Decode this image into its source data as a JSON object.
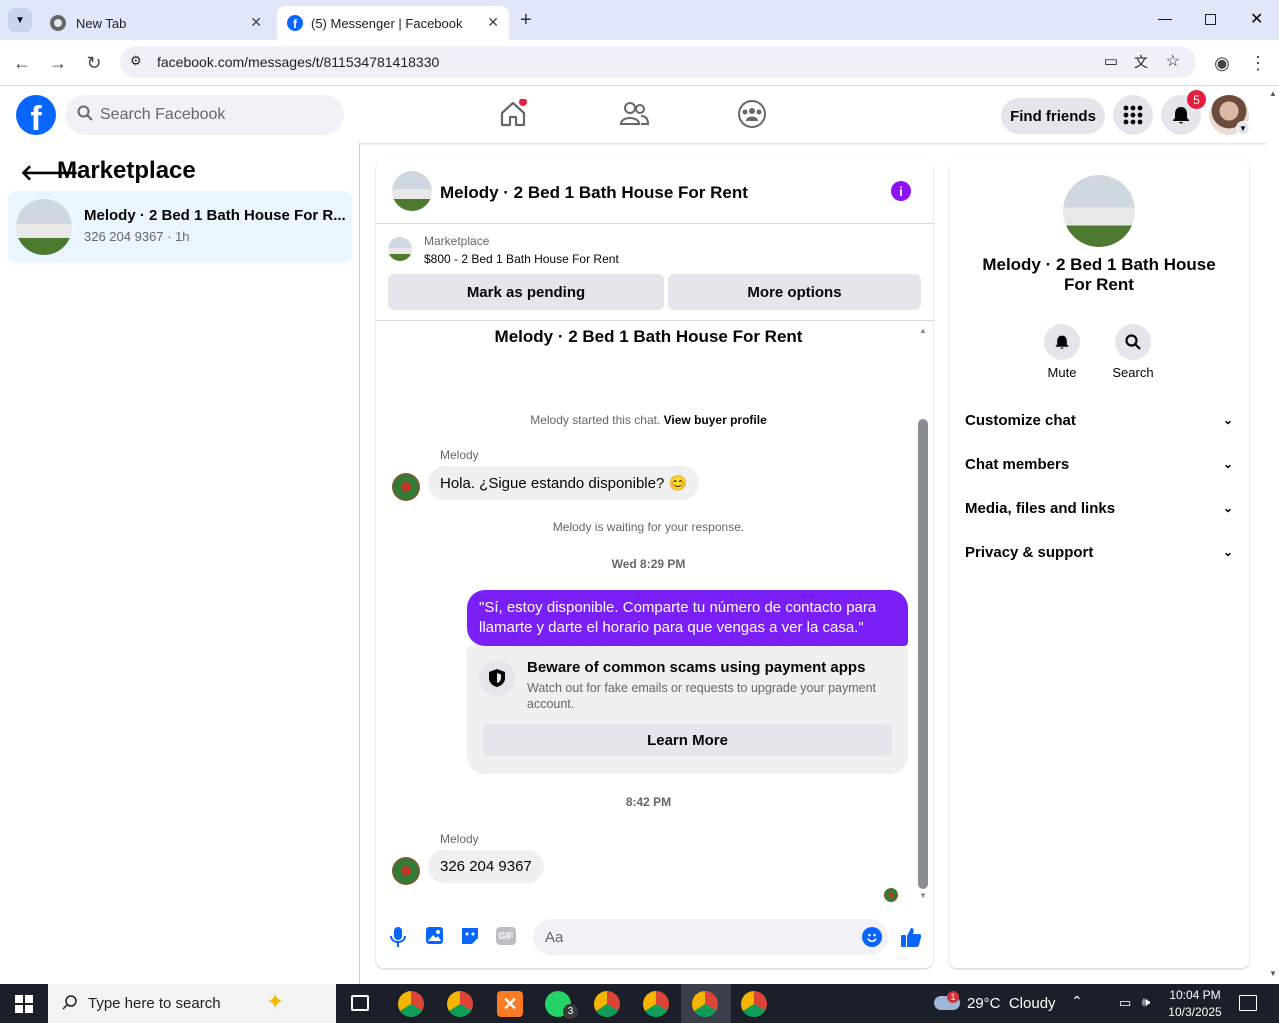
{
  "browser": {
    "tabs": [
      {
        "title": "New Tab",
        "active": false
      },
      {
        "title": "(5) Messenger | Facebook",
        "active": true
      }
    ],
    "url": "facebook.com/messages/t/811534781418330"
  },
  "fb_header": {
    "search_placeholder": "Search Facebook",
    "find_friends": "Find friends",
    "notifications_count": "5"
  },
  "left_panel": {
    "title": "Marketplace",
    "conversation": {
      "name": "Melody · 2 Bed 1 Bath House For R...",
      "preview": "326 204 9367 · 1h"
    }
  },
  "chat": {
    "title": "Melody · 2 Bed 1 Bath House For Rent",
    "listing_label": "Marketplace",
    "listing_price": "$800 - 2 Bed 1 Bath House For Rent",
    "mark_pending": "Mark as pending",
    "more_options": "More options",
    "thread_title": "Melody · 2 Bed 1 Bath House For Rent",
    "started_text": "Melody started this chat.",
    "view_profile": "View buyer profile",
    "sender1": "Melody",
    "msg1": "Hola. ¿Sigue estando disponible? 😊",
    "waiting": "Melody is waiting for your response.",
    "time1": "Wed 8:29 PM",
    "my_msg": "\"Sí, estoy disponible. Comparte tu número de contacto para llamarte y darte el horario para que vengas a ver la casa.\"",
    "warning_title": "Beware of common scams using payment apps",
    "warning_body": "Watch out for fake emails or requests to upgrade your payment account.",
    "learn_more": "Learn More",
    "time2": "8:42 PM",
    "sender2": "Melody",
    "msg2": "326 204 9367",
    "composer_placeholder": "Aa"
  },
  "right_panel": {
    "title": "Melody · 2 Bed 1 Bath House For Rent",
    "mute": "Mute",
    "search": "Search",
    "sections": [
      "Customize chat",
      "Chat members",
      "Media, files and links",
      "Privacy & support"
    ]
  },
  "taskbar": {
    "search_placeholder": "Type here to search",
    "weather": "29°C  Cloudy",
    "weather_badge": "1",
    "whatsapp_badge": "3",
    "time": "10:04 PM",
    "date": "10/3/2025"
  },
  "colors": {
    "fb_blue": "#0866ff",
    "my_bubble": "#7b1ff9",
    "notif_red": "#e41e3f"
  }
}
